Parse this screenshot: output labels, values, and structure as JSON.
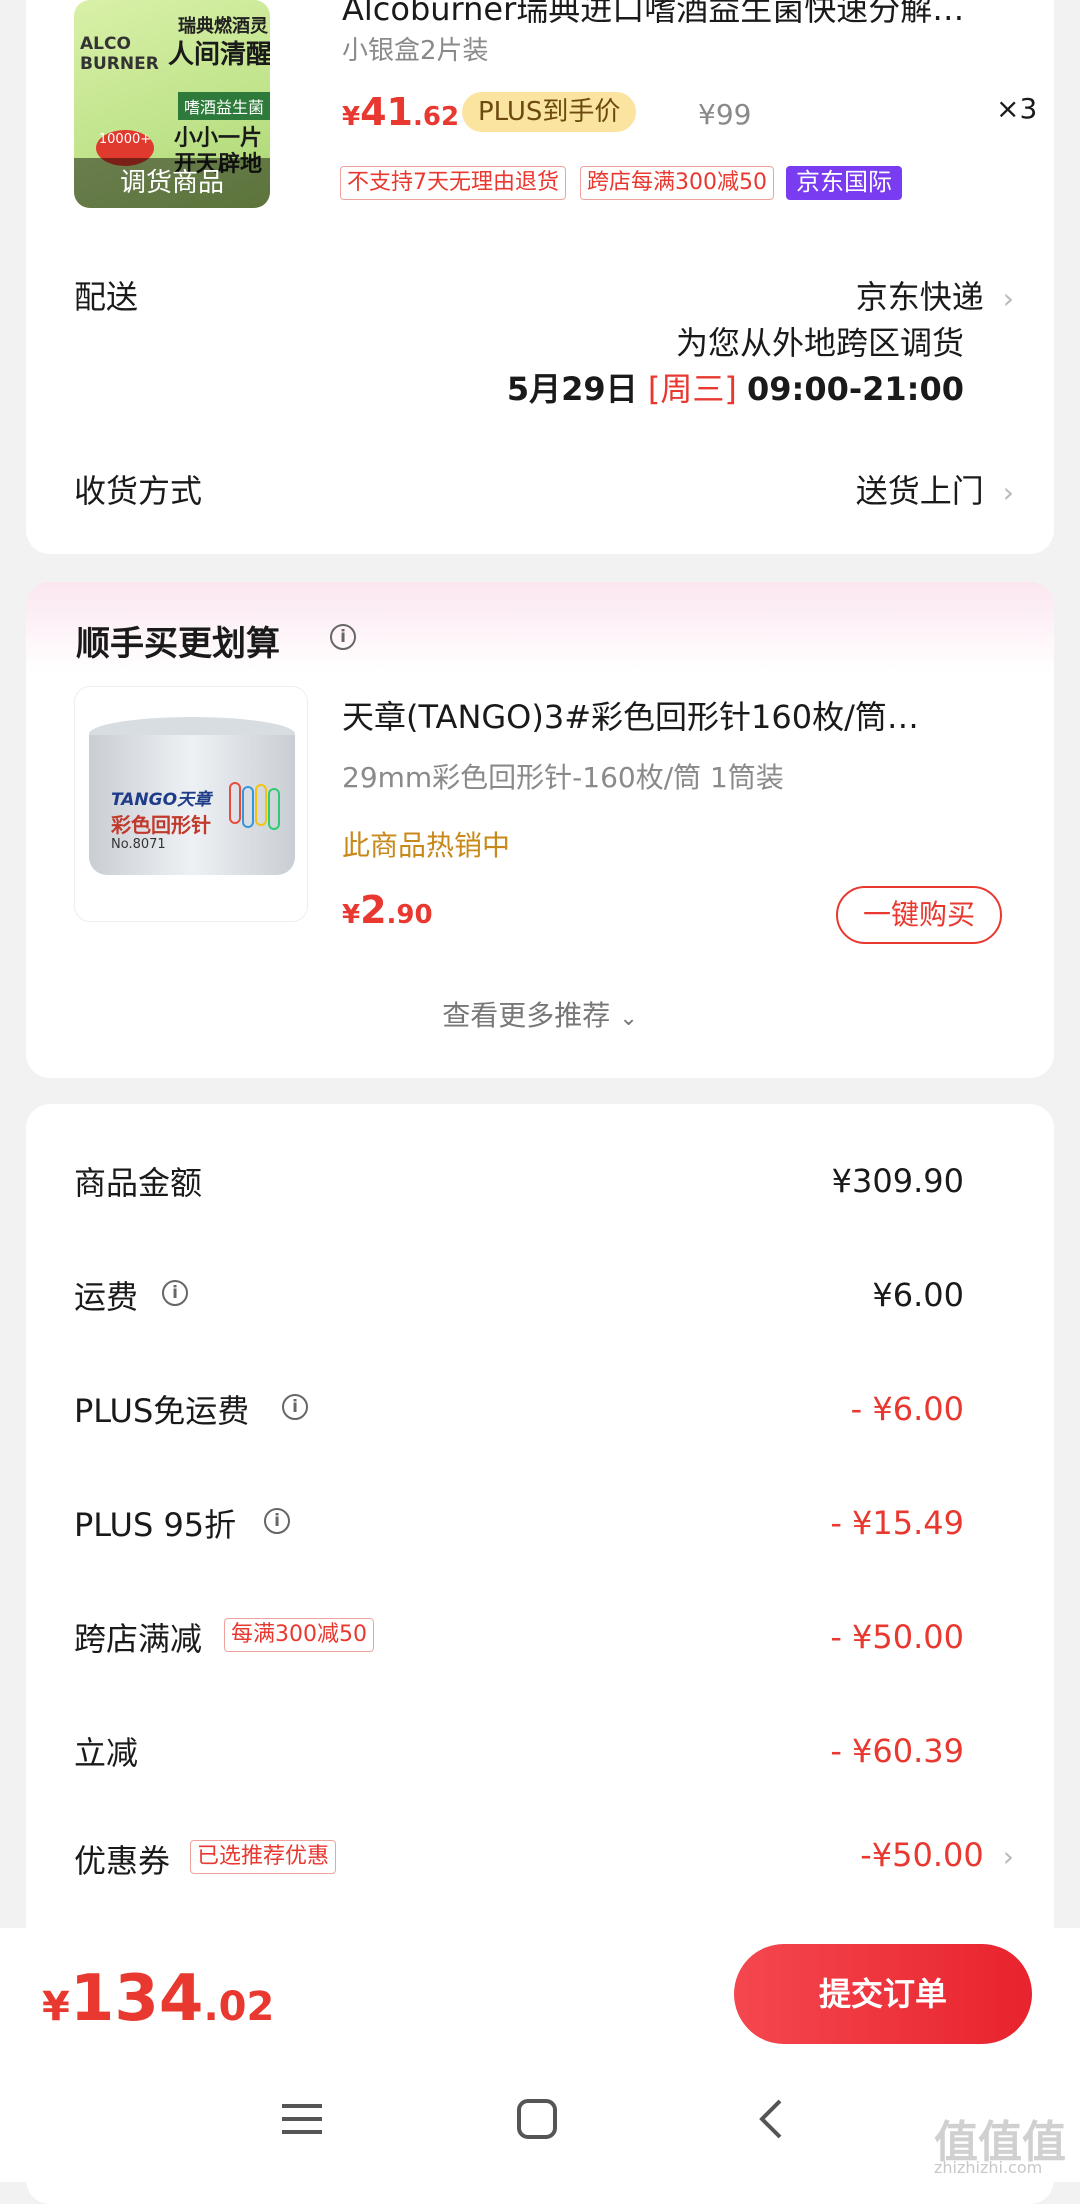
{
  "product1": {
    "title": "Alcoburner瑞典进口嗜酒益生菌快速分解…",
    "spec": "小银盒2片装",
    "image": {
      "brand": "ALCO BURNER",
      "top_text": "瑞典燃酒灵",
      "headline": "人间清醒",
      "badge": "嗜酒益生菌",
      "line1": "小小一片",
      "line2": "开天辟地",
      "sticker": "10000+",
      "overlay": "调货商品"
    },
    "price_int": "41",
    "price_dec": ".62",
    "currency": "¥",
    "plus_label": "PLUS到手价",
    "orig_price": "¥99",
    "qty": "×3",
    "tags": [
      "不支持7天无理由退货",
      "跨店每满300减50",
      "京东国际"
    ]
  },
  "delivery": {
    "label": "配送",
    "carrier": "京东快递",
    "note": "为您从外地跨区调货",
    "date": "5月29日",
    "weekday": "[周三]",
    "time": "09:00-21:00"
  },
  "receive": {
    "label": "收货方式",
    "value": "送货上门"
  },
  "recommend": {
    "title": "顺手买更划算",
    "product": {
      "title": "天章(TANGO)3#彩色回形针160枚/筒…",
      "spec": "29mm彩色回形针-160枚/筒 1筒装",
      "hot": "此商品热销中",
      "currency": "¥",
      "price_int": "2",
      "price_dec": ".90",
      "buy_label": "一键购买",
      "image": {
        "brand": "TANGO天章",
        "name": "彩色回形针",
        "code": "No.8071"
      }
    },
    "more": "查看更多推荐"
  },
  "summary": {
    "rows": [
      {
        "label": "商品金额",
        "value": "¥309.90"
      },
      {
        "label": "运费",
        "value": "¥6.00"
      },
      {
        "label": "PLUS免运费",
        "value": "- ¥6.00"
      },
      {
        "label": "PLUS 95折",
        "value": "- ¥15.49"
      },
      {
        "label": "跨店满减",
        "tag": "每满300减50",
        "value": "- ¥50.00"
      },
      {
        "label": "立减",
        "value": "- ¥60.39"
      },
      {
        "label": "优惠券",
        "tag": "已选推荐优惠",
        "value": "-¥50.00"
      }
    ]
  },
  "footer": {
    "currency": "¥",
    "total_int": "134",
    "total_dec": ".02",
    "submit_label": "提交订单"
  },
  "watermark": {
    "logo": "值值值",
    "url": "zhizhizhi.com"
  },
  "colors": {
    "accent": "#e8382f",
    "plus_gold": "#fbe3a0",
    "purple": "#7a3cf0",
    "gray_text": "#8a8a8a"
  }
}
